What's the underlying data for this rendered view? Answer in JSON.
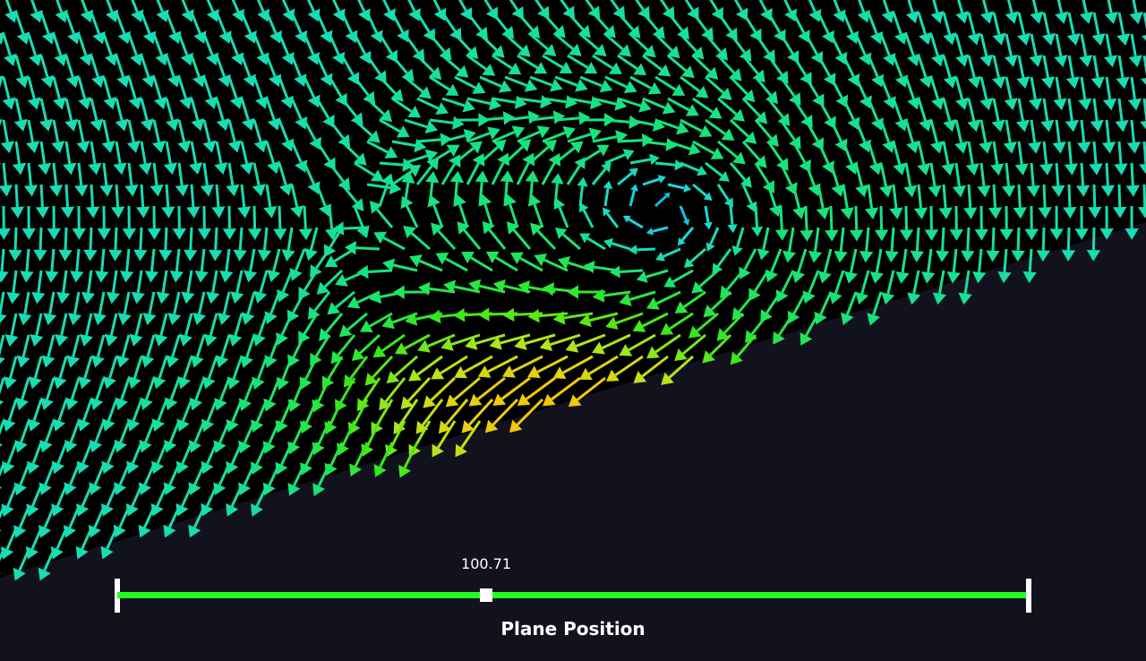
{
  "slider": {
    "value_text": "100.71",
    "title": "Plane Position",
    "position_fraction": 0.405,
    "track_color": "#22ff22",
    "cap_color": "#ffffff",
    "handle_color": "#ffffff"
  },
  "scene": {
    "background_color": "#000000",
    "ground_color": "#12121f",
    "colormap": [
      "#0a1aa0",
      "#1a7cff",
      "#18d8e0",
      "#17e37a",
      "#36e81a",
      "#aee61a",
      "#e8d010",
      "#ffc000"
    ]
  }
}
